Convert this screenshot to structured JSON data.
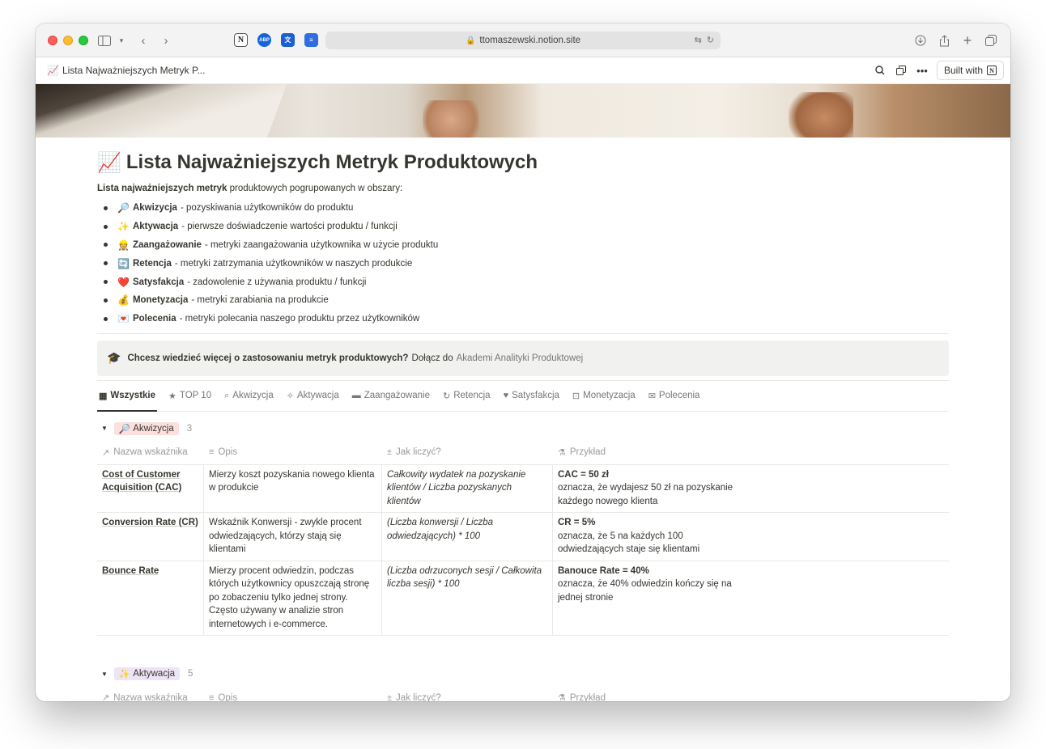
{
  "browser": {
    "url": "ttomaszewski.notion.site",
    "extensions": [
      "notion-extension-icon",
      "adblock-icon",
      "translate-icon",
      "todoist-icon"
    ]
  },
  "tab": {
    "emoji": "📈",
    "title": "Lista Najważniejszych Metryk P..."
  },
  "topbar": {
    "built_with_label": "Built with",
    "notion_logo_letter": "N"
  },
  "page": {
    "emoji": "📈",
    "title": "Lista Najważniejszych Metryk Produktowych",
    "intro_bold": "Lista najważniejszych metryk",
    "intro_rest": "produktowych pogrupowanych w obszary:",
    "bullets": [
      {
        "emoji": "🔎",
        "name": "Akwizycja",
        "desc": "- pozyskiwania użytkowników do produktu"
      },
      {
        "emoji": "✨",
        "name": "Aktywacja",
        "desc": "- pierwsze doświadczenie wartości produktu / funkcji"
      },
      {
        "emoji": "👷",
        "name": "Zaangażowanie",
        "desc": "- metryki zaangażowania użytkownika w użycie produktu"
      },
      {
        "emoji": "🔄",
        "name": "Retencja",
        "desc": "- metryki zatrzymania użytkowników w naszych produkcie"
      },
      {
        "emoji": "❤️",
        "name": "Satysfakcja",
        "desc": "- zadowolenie z używania produktu / funkcji"
      },
      {
        "emoji": "💰",
        "name": "Monetyzacja",
        "desc": "- metryki zarabiania na produkcie"
      },
      {
        "emoji": "💌",
        "name": "Polecenia",
        "desc": "- metryki polecania naszego produktu przez użytkowników"
      }
    ],
    "callout": {
      "emoji": "🎓",
      "bold": "Chcesz wiedzieć więcej o zastosowaniu metryk produktowych?",
      "text": "Dołącz do",
      "link": "Akademi Analityki Produktowej"
    }
  },
  "views": [
    {
      "icon": "▦",
      "label": "Wszystkie",
      "active": true
    },
    {
      "icon": "★",
      "label": "TOP 10"
    },
    {
      "icon": "⌕",
      "label": "Akwizycja"
    },
    {
      "icon": "✧",
      "label": "Aktywacja"
    },
    {
      "icon": "▬",
      "label": "Zaangażowanie"
    },
    {
      "icon": "↻",
      "label": "Retencja"
    },
    {
      "icon": "♥",
      "label": "Satysfakcja"
    },
    {
      "icon": "⊡",
      "label": "Monetyzacja"
    },
    {
      "icon": "✉",
      "label": "Polecenia"
    }
  ],
  "columns": [
    {
      "icon": "↗",
      "label": "Nazwa wskaźnika"
    },
    {
      "icon": "≡",
      "label": "Opis"
    },
    {
      "icon": "±",
      "label": "Jak liczyć?"
    },
    {
      "icon": "⚗",
      "label": "Przykład"
    }
  ],
  "groups": [
    {
      "emoji": "🔎",
      "label": "Akwizycja",
      "count": "3",
      "color": "#fde0dd",
      "rows": [
        {
          "name": "Cost of Customer Acquisition (CAC)",
          "desc": "Mierzy koszt pozyskania nowego klienta w produkcie",
          "formula": "Całkowity wydatek na pozyskanie klientów / Liczba pozyskanych klientów",
          "ex_bold": "CAC = 50 zł",
          "ex_text": "oznacza, że wydajesz 50 zł na pozyskanie każdego nowego klienta"
        },
        {
          "name": "Conversion Rate (CR)",
          "desc": "Wskaźnik Konwersji - zwykle procent odwiedzających, którzy stają się klientami",
          "formula": "(Liczba konwersji / Liczba odwiedzających) * 100",
          "ex_bold": "CR = 5%",
          "ex_text": "oznacza, że 5 na każdych 100 odwiedzających staje się klientami"
        },
        {
          "name": "Bounce Rate",
          "desc": "Mierzy procent odwiedzin, podczas których użytkownicy opuszczają stronę po zobaczeniu tylko jednej strony. Często używany w analizie stron internetowych i e-commerce.",
          "formula": "(Liczba odrzuconych sesji / Całkowita liczba sesji) * 100",
          "ex_bold": "Banouce Rate = 40%",
          "ex_text": "oznacza, że 40% odwiedzin kończy się na jednej stronie"
        }
      ]
    },
    {
      "emoji": "✨",
      "label": "Aktywacja",
      "count": "5",
      "color": "#ede4f7",
      "rows": []
    }
  ]
}
